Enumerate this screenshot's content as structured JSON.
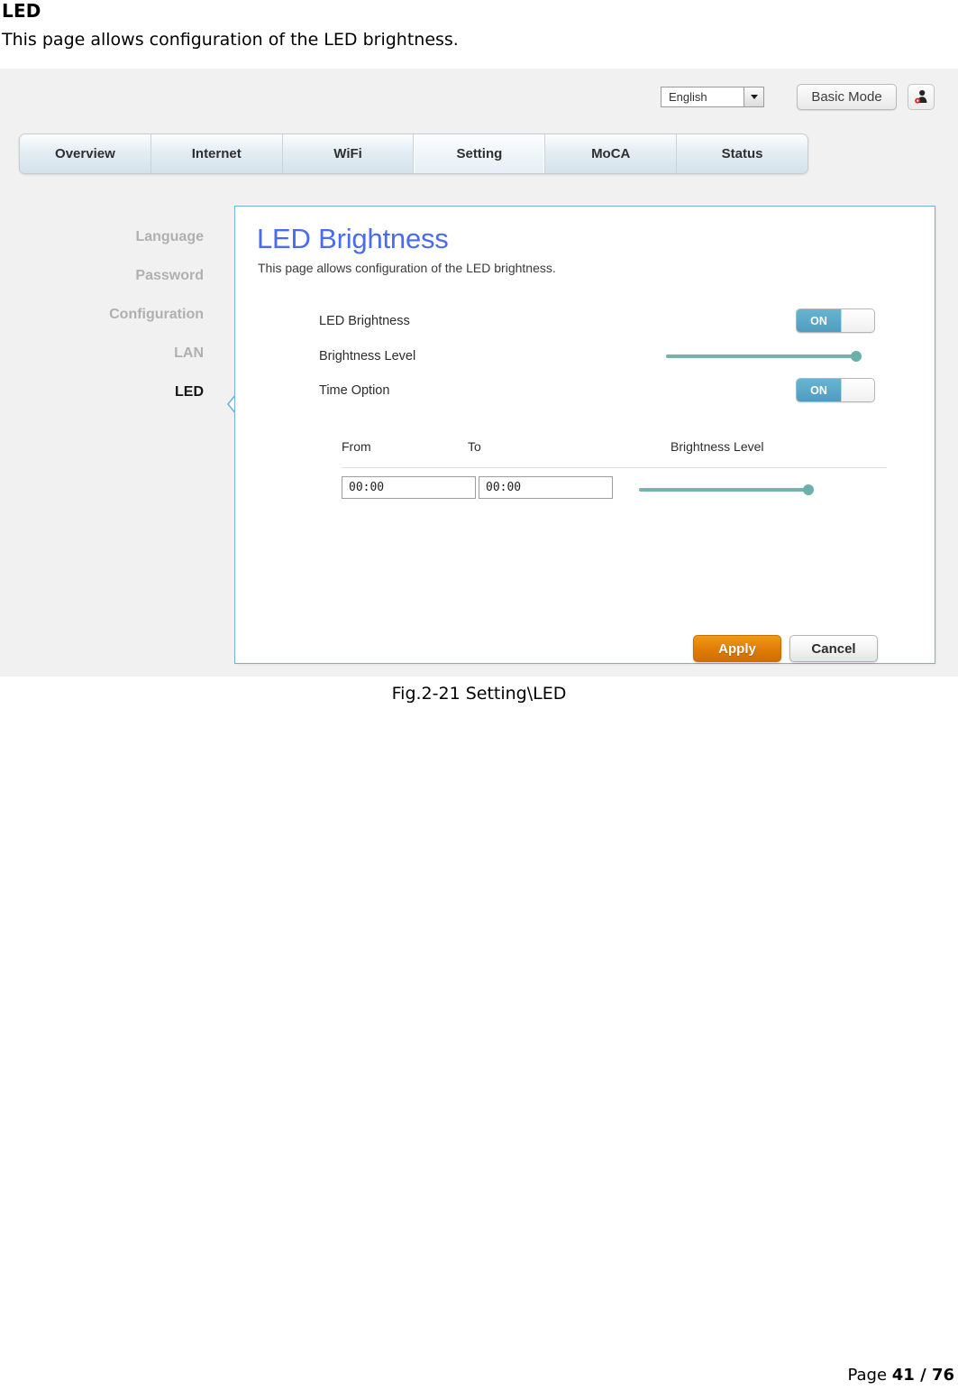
{
  "document": {
    "heading": "LED",
    "intro": "This page allows configuration of the LED brightness.",
    "caption": "Fig.2-21 Setting\\LED",
    "footer_prefix": "Page ",
    "footer_pages": "41 / 76"
  },
  "topbar": {
    "language_value": "English",
    "mode_button": "Basic Mode",
    "user_icon": "user-account-icon"
  },
  "nav": {
    "tabs": [
      {
        "label": "Overview",
        "active": false
      },
      {
        "label": "Internet",
        "active": false
      },
      {
        "label": "WiFi",
        "active": false
      },
      {
        "label": "Setting",
        "active": true
      },
      {
        "label": "MoCA",
        "active": false
      },
      {
        "label": "Status",
        "active": false
      }
    ]
  },
  "sidebar": {
    "items": [
      {
        "label": "Language",
        "active": false
      },
      {
        "label": "Password",
        "active": false
      },
      {
        "label": "Configuration",
        "active": false
      },
      {
        "label": "LAN",
        "active": false
      },
      {
        "label": "LED",
        "active": true
      }
    ]
  },
  "panel": {
    "title": "LED Brightness",
    "subtitle": "This page allows configuration of the LED brightness.",
    "fields": {
      "led_brightness_label": "LED Brightness",
      "led_brightness_state": "ON",
      "brightness_level_label": "Brightness Level",
      "brightness_level_value": 100,
      "time_option_label": "Time Option",
      "time_option_state": "ON"
    },
    "time_table": {
      "headers": [
        "From",
        "To",
        "Brightness Level"
      ],
      "rows": [
        {
          "from": "00:00",
          "to": "00:00",
          "level": 100
        }
      ]
    },
    "buttons": {
      "apply": "Apply",
      "cancel": "Cancel"
    }
  },
  "colors": {
    "accent_blue": "#4a6bf0",
    "panel_border": "#6eb4d8",
    "toggle_on": "#5aa6c6",
    "slider": "#74b3ae",
    "apply_orange": "#e07e06"
  }
}
